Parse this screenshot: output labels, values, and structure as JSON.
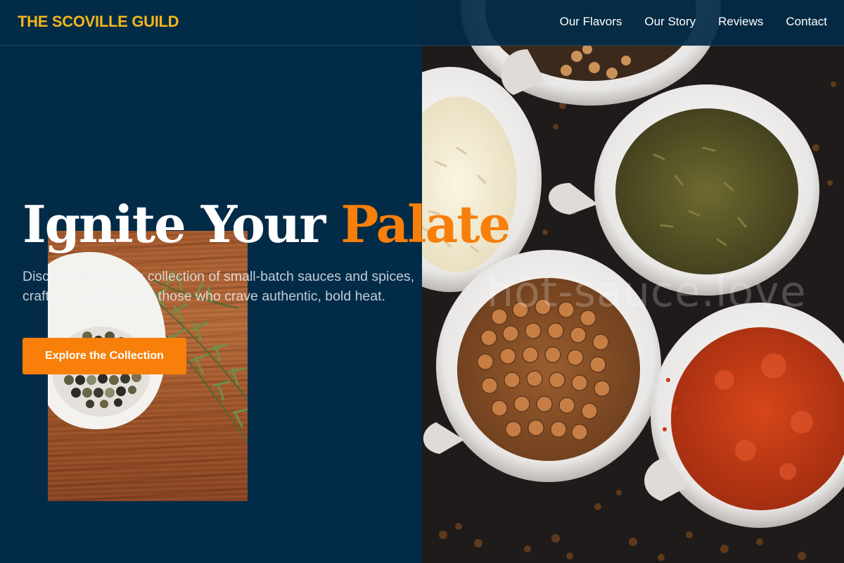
{
  "header": {
    "logo": "THE SCOVILLE GUILD",
    "nav": [
      "Our Flavors",
      "Our Story",
      "Reviews",
      "Contact"
    ]
  },
  "hero": {
    "title_main": "Ignite Your",
    "title_accent": "Palate",
    "subtitle": "Discover the artisan collection of small-batch sauces and spices, crafted specifically for those who crave authentic, bold heat.",
    "cta_label": "Explore the Collection"
  },
  "photo": {
    "watermark": "hot-sauce.love"
  },
  "colors": {
    "background": "#022b47",
    "logo": "#f4b61a",
    "accent": "#f77f0a",
    "text": "#ffffff"
  }
}
